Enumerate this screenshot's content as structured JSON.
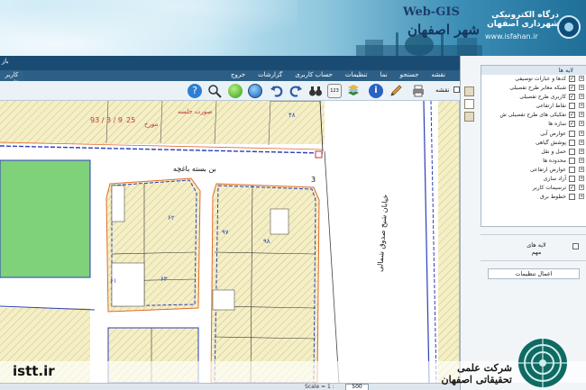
{
  "header": {
    "webgis": "Web-GIS",
    "city_name": "شهر اصفهان",
    "portal_title": "درگاه الکترونیکی شهرداری اصفهان",
    "portal_url": "www.isfahan.ir"
  },
  "strip": {
    "left_text": "باز"
  },
  "left_tab": {
    "label": "کاربر\nقارب"
  },
  "menu": {
    "items": [
      "نقشه",
      "جستجو",
      "نما",
      "تنظیمات",
      "حساب کاربری",
      "گزارشات",
      "خروج"
    ]
  },
  "toolbar": {
    "map_label": "نقشه",
    "tools": [
      "print-icon",
      "pencil-icon",
      "info-icon",
      "layer-icon",
      "coordinate-icon",
      "binoculars-icon",
      "redo-icon",
      "undo-icon",
      "globe-icon",
      "zoom-full-icon",
      "zoom-in-icon",
      "help-icon"
    ]
  },
  "map": {
    "street_name": "بن بسته باغچه",
    "avenue_name": "خیابان شیخ صدوق شمالی",
    "annotation_header": "صورت جلسه",
    "annotation_line2": "مورخ",
    "annotation_number": "25",
    "annotation_date": "93 / 3 / 9",
    "parcel_number": "3",
    "plot_labels": [
      "۴۸",
      "۶۲",
      "۶۳",
      "۶۱",
      "۹۷",
      "۹۸"
    ]
  },
  "status": {
    "scale_label": "Scale = 1 :",
    "scale_value": "500"
  },
  "layers": {
    "title": "لایه ها",
    "items": [
      {
        "label": "کدها و عبارات توصیفی",
        "checked": true
      },
      {
        "label": "شبکه معابر طرح تفصیلی",
        "checked": true
      },
      {
        "label": "کاربری طرح تفصیلی",
        "checked": true
      },
      {
        "label": "نقاط ارتفاعی",
        "checked": false
      },
      {
        "label": "تفکیکی های طرح تفصیلی ش",
        "checked": true
      },
      {
        "label": "سازه ها",
        "checked": true
      },
      {
        "label": "عوارض آبی",
        "checked": false
      },
      {
        "label": "پوشش گیاهی",
        "checked": false
      },
      {
        "label": "حمل و نقل",
        "checked": false
      },
      {
        "label": "محدوده ها",
        "checked": false
      },
      {
        "label": "عوارض ارتفاعی",
        "checked": false
      },
      {
        "label": "آزاد سازی",
        "checked": false
      },
      {
        "label": "ترسیمات کاربر",
        "checked": true
      },
      {
        "label": "خطوط برق",
        "checked": false
      }
    ],
    "important_label": "لایه های\nمهم",
    "apply_label": "اعمال تنظیمات"
  },
  "watermark": {
    "site": "istt.ir",
    "company": "شرکت علمی تحقیقاتی اصفهان"
  },
  "colors": {
    "menubar": "#2d5f86",
    "strip": "#1a4b73",
    "parcel_fill": "#f3eec4",
    "green_area": "#7fd27a",
    "street_line": "#2b3fb8",
    "annotation": "#c0392b"
  }
}
